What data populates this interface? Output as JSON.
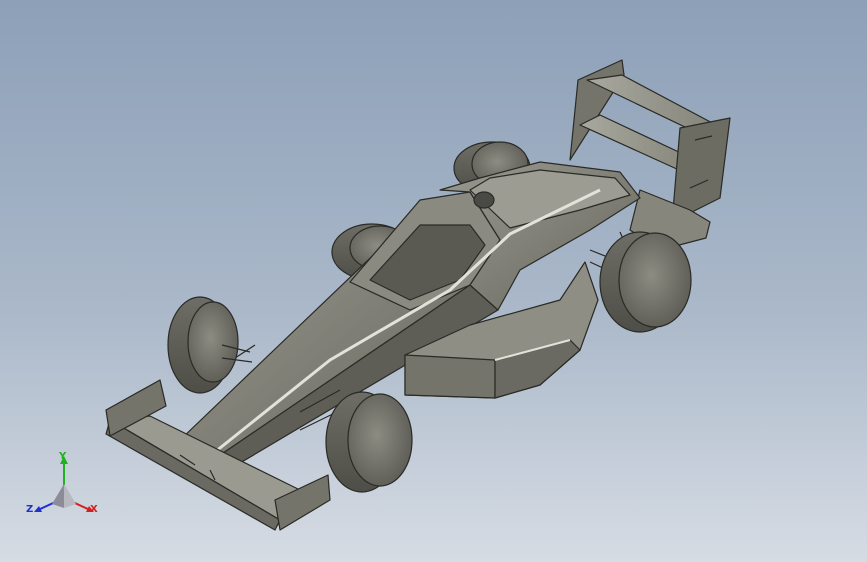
{
  "viewport": {
    "background_top": "#8da0b8",
    "background_bottom": "#d6dce4"
  },
  "model": {
    "name": "race-car",
    "shade_color": "#7e7e74",
    "edge_color": "#2a2a26"
  },
  "triad": {
    "x_label": "X",
    "y_label": "Y",
    "z_label": "Z",
    "x_color": "#d42020",
    "y_color": "#20b020",
    "z_color": "#2030d0"
  }
}
